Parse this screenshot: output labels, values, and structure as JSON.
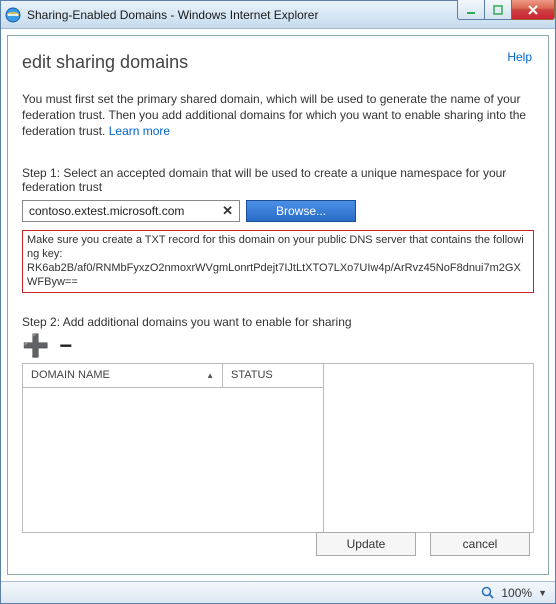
{
  "window": {
    "title": "Sharing-Enabled Domains - Windows Internet Explorer"
  },
  "page": {
    "help_label": "Help",
    "title": "edit sharing domains",
    "intro_text": "You must first set the primary shared domain, which will be used to generate the name of your federation trust. Then you add additional domains for which you want to enable sharing into the federation trust. ",
    "learn_more_label": "Learn more",
    "step1_label": "Step 1: Select an accepted domain that will be used to create a unique namespace for your federation trust",
    "domain_value": "contoso.extest.microsoft.com",
    "browse_label": "Browse...",
    "txt_warning_intro": "Make sure you create a TXT record for this domain on your public DNS server that contains the following key:",
    "txt_warning_key": "RK6ab2B/af0/RNMbFyxzO2nmoxrWVgmLonrtPdejt7IJtLtXTO7LXo7UIw4p/ArRvz45NoF8dnui7m2GXWFByw==",
    "step2_label": "Step 2: Add additional domains you want to enable for sharing",
    "grid": {
      "col_domain": "DOMAIN NAME",
      "col_status": "STATUS"
    },
    "update_label": "Update",
    "cancel_label": "cancel"
  },
  "statusbar": {
    "zoom": "100%"
  }
}
